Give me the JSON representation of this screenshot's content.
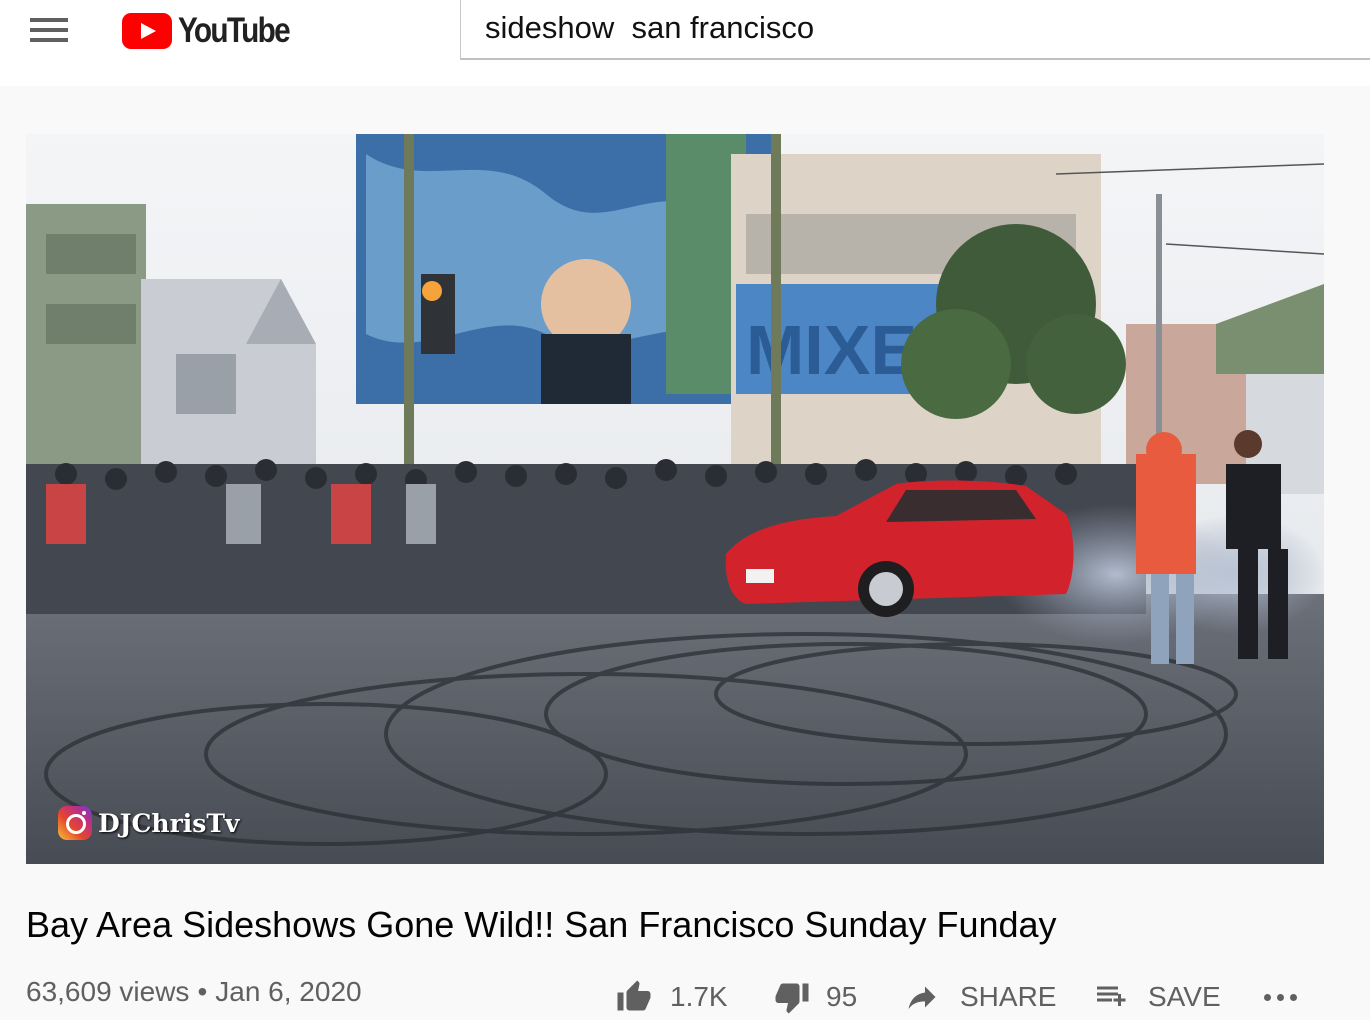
{
  "header": {
    "logo_text": "YouTube",
    "search_value": "sideshow  san francisco"
  },
  "video": {
    "watermark": "DJChrisTv",
    "title": "Bay Area Sideshows Gone Wild!! San Francisco Sunday Funday",
    "views": "63,609 views",
    "separator": "•",
    "date": "Jan 6, 2020"
  },
  "actions": {
    "like_count": "1.7K",
    "dislike_count": "95",
    "share_label": "SHARE",
    "save_label": "SAVE"
  },
  "colors": {
    "brand_red": "#ff0000",
    "text_secondary": "#606060"
  }
}
